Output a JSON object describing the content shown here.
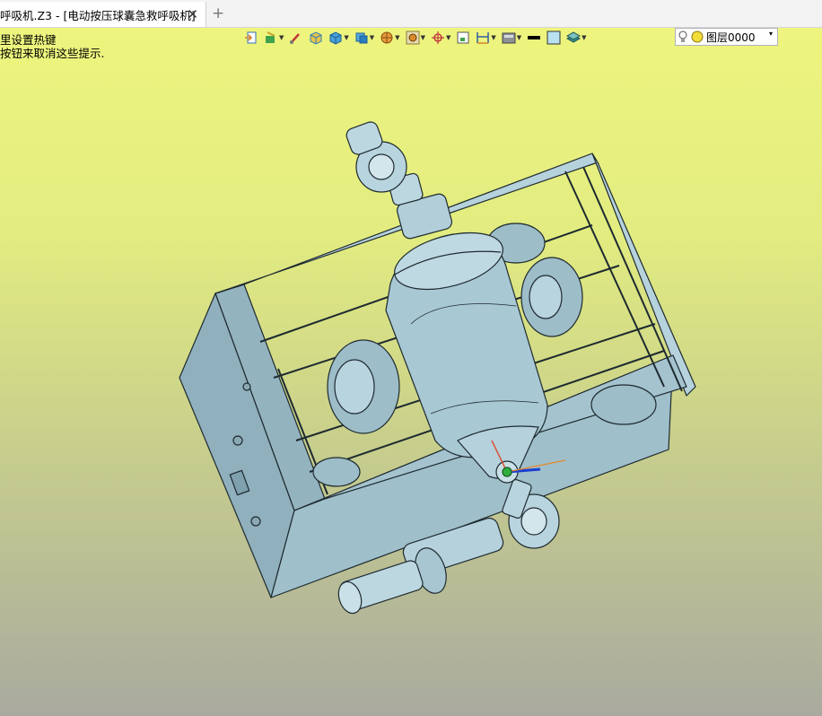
{
  "tab": {
    "title": "呼吸机.Z3 - [电动按压球囊急救呼吸机]",
    "close_glyph": "✕",
    "add_glyph": "+"
  },
  "hints": {
    "line1": "里设置热键",
    "line2": "按钮来取消这些提示."
  },
  "toolbar": {
    "icons": [
      "export-icon",
      "material-icon",
      "brush-icon",
      "shade-cube-icon",
      "cube-icon",
      "view-cube-icon",
      "sphere-icon",
      "render-icon",
      "axis-icon",
      "fit-icon",
      "measure-icon",
      "display-icon",
      "color-swatch-icon",
      "layer-icon"
    ],
    "layer": {
      "label": "图层0000",
      "arrow": "▾"
    }
  },
  "colors": {
    "viewport_top": "#eef57e",
    "viewport_bottom": "#a9aa9f",
    "model_fill": "#a9c7d2",
    "model_stroke": "#1e2a30"
  }
}
